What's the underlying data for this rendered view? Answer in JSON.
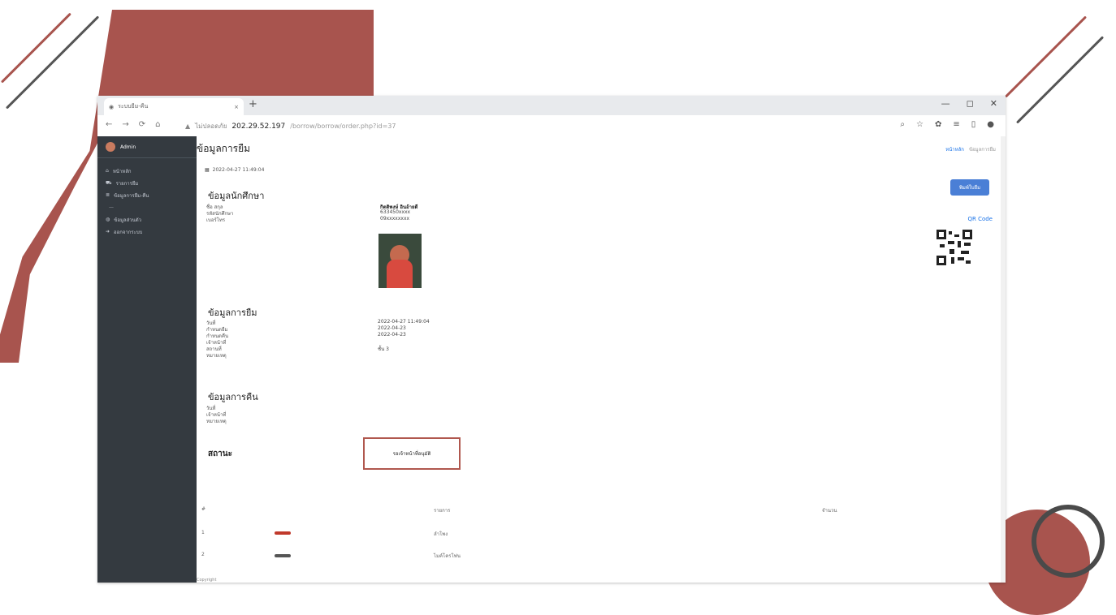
{
  "colors": {
    "accent": "#a8544e",
    "sidebar": "#343a40",
    "link": "#1a73e8",
    "button": "#4a7fd6"
  },
  "browser": {
    "tab_title": "ระบบยืม-คืน",
    "new_tab": "+",
    "close_tab": "×",
    "window_controls": [
      "—",
      "◻",
      "✕"
    ],
    "nav": [
      "←",
      "→",
      "⟳",
      "⌂"
    ],
    "not_secure": "ไม่ปลอดภัย",
    "url_host": "202.29.52.197",
    "url_path": "/borrow/borrow/order.php?id=37"
  },
  "sidebar": {
    "brand": "Admin",
    "items": [
      {
        "icon": "home-icon",
        "label": "หน้าหลัก"
      },
      {
        "icon": "cart-icon",
        "label": "รายการยืม"
      },
      {
        "icon": "list-icon",
        "label": "ข้อมูลการยืม-คืน"
      },
      {
        "icon": "user-icon",
        "label": "ข้อมูลส่วนตัว"
      },
      {
        "icon": "logout-icon",
        "label": "ออกจากระบบ"
      }
    ]
  },
  "header": {
    "title": "ข้อมูลการยืม",
    "crumb_home": "หน้าหลัก",
    "crumb_current": "ข้อมูลการยืม"
  },
  "order_date": "2022-04-27 11:49:04",
  "student": {
    "heading": "ข้อมูลนักศึกษา",
    "labels": [
      "ชื่อ สกุล",
      "รหัสนักศึกษา",
      "เบอร์โทร"
    ],
    "values": [
      "กิตติพงษ์ อินอ้ายดี",
      "633450xxxx",
      "09xxxxxxxx"
    ]
  },
  "print_button": "พิมพ์ใบยืม",
  "qr_link": "QR Code",
  "borrow": {
    "heading": "ข้อมูลการยืม",
    "labels": [
      "วันที่",
      "กำหนดยืม",
      "กำหนดคืน",
      "เจ้าหน้าที่",
      "สถานที่",
      "หมายเหตุ"
    ],
    "values": [
      "2022-04-27 11:49:04",
      "2022-04-23",
      "2022-04-23",
      "",
      "ชั้น 3",
      ""
    ]
  },
  "return": {
    "heading": "ข้อมูลการคืน",
    "labels": [
      "วันที่",
      "เจ้าหน้าที่",
      "หมายเหตุ"
    ]
  },
  "status": {
    "label": "สถานะ",
    "value": "รอเจ้าหน้าที่อนุมัติ"
  },
  "items_table": {
    "headers": [
      "#",
      "รายการ",
      "จำนวน"
    ],
    "rows": [
      {
        "no": "1",
        "name": "ลำโพง"
      },
      {
        "no": "2",
        "name": "ไมค์โครโฟน"
      }
    ]
  },
  "footer": "Copyright"
}
